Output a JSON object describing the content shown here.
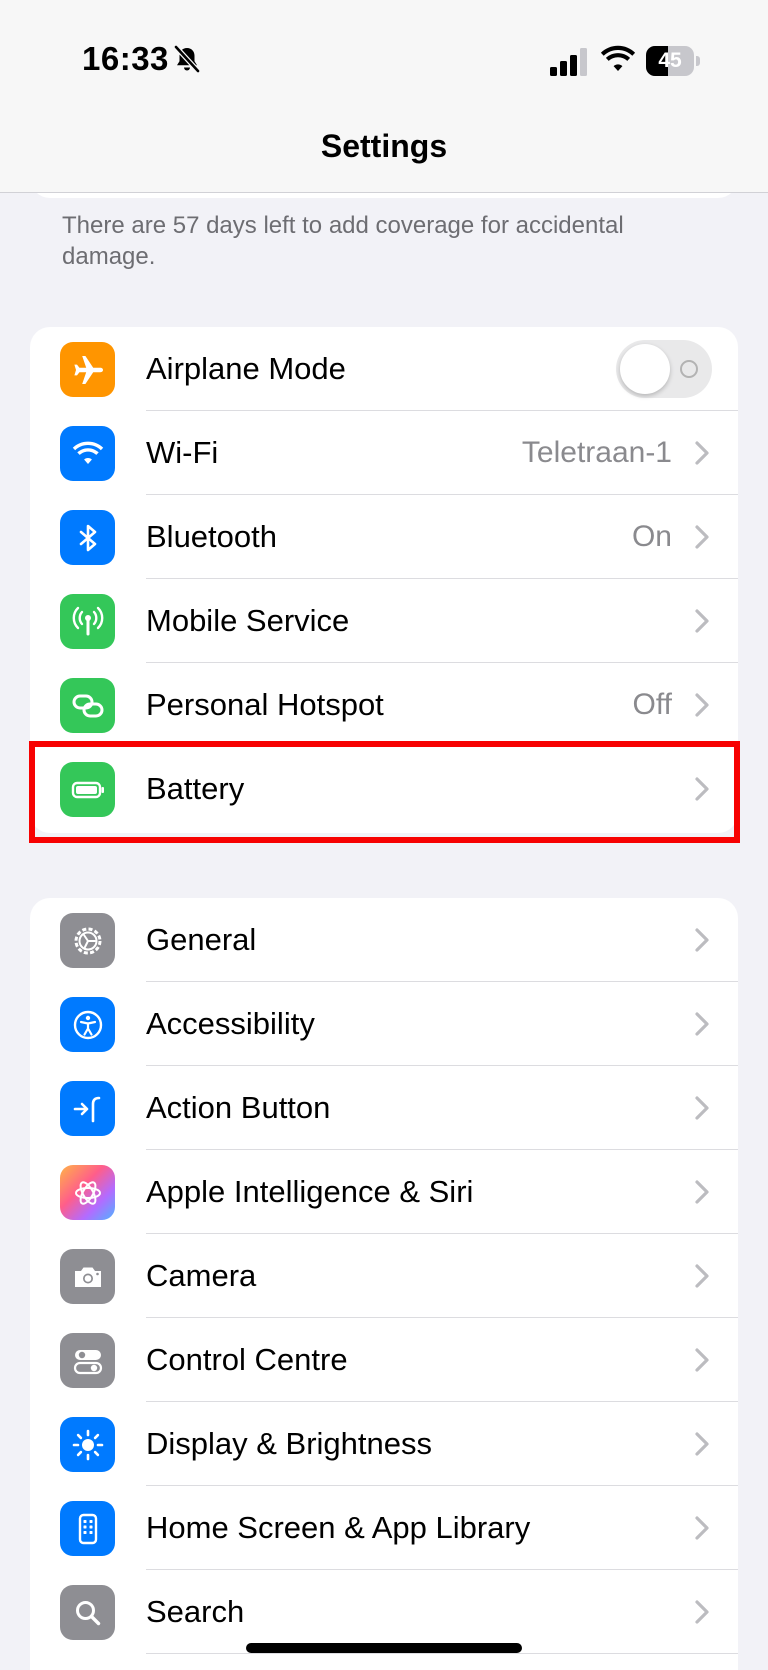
{
  "status_bar": {
    "time": "16:33",
    "battery_percent": "45",
    "battery_level": 0.45,
    "silent_mode_icon": "bell-slash-icon",
    "signal_icon": "cellular-signal-icon",
    "wifi_icon": "wifi-icon"
  },
  "nav": {
    "title": "Settings"
  },
  "coverage_note": "There are 57 days left to add coverage for accidental damage.",
  "connectivity_group": [
    {
      "name": "airplane-mode",
      "label": "Airplane Mode",
      "icon": "airplane-icon",
      "color": "#ff9500",
      "control": "toggle",
      "toggle_on": false
    },
    {
      "name": "wifi",
      "label": "Wi-Fi",
      "icon": "wifi-icon",
      "color": "#007aff",
      "value": "Teletraan-1"
    },
    {
      "name": "bluetooth",
      "label": "Bluetooth",
      "icon": "bluetooth-icon",
      "color": "#007aff",
      "value": "On"
    },
    {
      "name": "mobile-service",
      "label": "Mobile Service",
      "icon": "antenna-icon",
      "color": "#34c759",
      "value": ""
    },
    {
      "name": "personal-hotspot",
      "label": "Personal Hotspot",
      "icon": "link-icon",
      "color": "#34c759",
      "value": "Off"
    },
    {
      "name": "battery",
      "label": "Battery",
      "icon": "battery-icon",
      "color": "#34c759",
      "value": "",
      "highlighted": true
    }
  ],
  "general_group": [
    {
      "name": "general",
      "label": "General",
      "icon": "gear-icon",
      "color": "#8e8e93"
    },
    {
      "name": "accessibility",
      "label": "Accessibility",
      "icon": "accessibility-icon",
      "color": "#007aff"
    },
    {
      "name": "action-button",
      "label": "Action Button",
      "icon": "action-button-icon",
      "color": "#007aff"
    },
    {
      "name": "apple-intelligence-siri",
      "label": "Apple Intelligence & Siri",
      "icon": "apple-intelligence-icon",
      "color": "#c86dd7"
    },
    {
      "name": "camera",
      "label": "Camera",
      "icon": "camera-icon",
      "color": "#8e8e93"
    },
    {
      "name": "control-centre",
      "label": "Control Centre",
      "icon": "toggles-icon",
      "color": "#8e8e93"
    },
    {
      "name": "display-brightness",
      "label": "Display & Brightness",
      "icon": "sun-icon",
      "color": "#007aff"
    },
    {
      "name": "home-screen-app-library",
      "label": "Home Screen & App Library",
      "icon": "phone-grid-icon",
      "color": "#007aff"
    },
    {
      "name": "search",
      "label": "Search",
      "icon": "magnifier-icon",
      "color": "#8e8e93"
    }
  ],
  "highlight_color": "#f70202"
}
